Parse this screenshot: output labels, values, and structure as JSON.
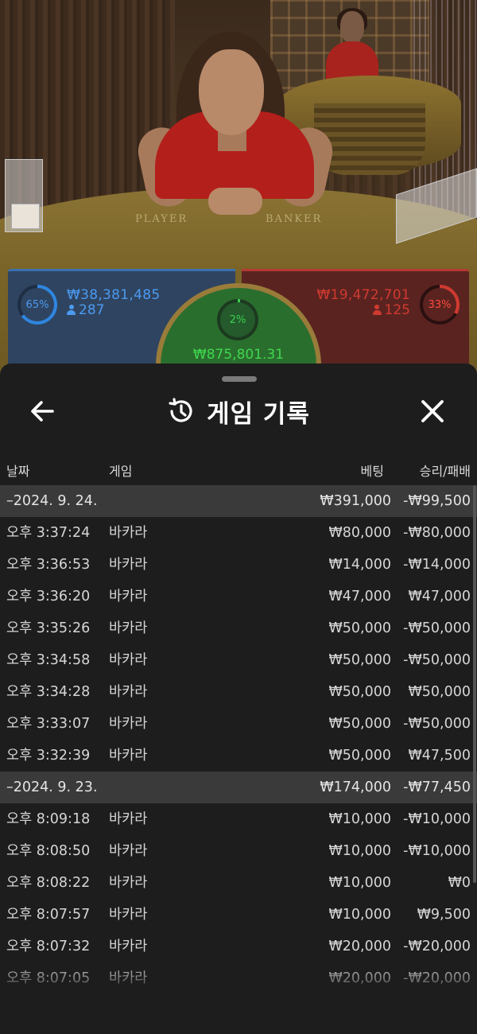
{
  "table": {
    "player_label": "PLAYER",
    "banker_label": "BANKER"
  },
  "bets": {
    "player": {
      "percent_label": "65%",
      "percent": 65,
      "amount": "₩38,381,485",
      "players": "287",
      "color": "#4b9af0"
    },
    "banker": {
      "percent_label": "33%",
      "percent": 33,
      "amount": "₩19,472,701",
      "players": "125",
      "color": "#d03a30"
    },
    "tie": {
      "percent_label": "2%",
      "percent": 2,
      "amount": "₩875,801.31",
      "color": "#41d64f"
    }
  },
  "sheet": {
    "title": "게임 기록",
    "icons": {
      "back": "arrow-left-icon",
      "history": "history-clock-icon",
      "close": "close-x-icon"
    },
    "columns": {
      "date": "날짜",
      "game": "게임",
      "bet": "베팅",
      "result": "승리/패배"
    },
    "rows": [
      {
        "type": "date",
        "time": "–2024. 9. 24.",
        "game": "",
        "bet": "₩391,000",
        "result": "-₩99,500"
      },
      {
        "type": "entry",
        "time": "오후 3:37:24",
        "game": "바카라",
        "bet": "₩80,000",
        "result": "-₩80,000"
      },
      {
        "type": "entry",
        "time": "오후 3:36:53",
        "game": "바카라",
        "bet": "₩14,000",
        "result": "-₩14,000"
      },
      {
        "type": "entry",
        "time": "오후 3:36:20",
        "game": "바카라",
        "bet": "₩47,000",
        "result": "₩47,000"
      },
      {
        "type": "entry",
        "time": "오후 3:35:26",
        "game": "바카라",
        "bet": "₩50,000",
        "result": "-₩50,000"
      },
      {
        "type": "entry",
        "time": "오후 3:34:58",
        "game": "바카라",
        "bet": "₩50,000",
        "result": "-₩50,000"
      },
      {
        "type": "entry",
        "time": "오후 3:34:28",
        "game": "바카라",
        "bet": "₩50,000",
        "result": "₩50,000"
      },
      {
        "type": "entry",
        "time": "오후 3:33:07",
        "game": "바카라",
        "bet": "₩50,000",
        "result": "-₩50,000"
      },
      {
        "type": "entry",
        "time": "오후 3:32:39",
        "game": "바카라",
        "bet": "₩50,000",
        "result": "₩47,500"
      },
      {
        "type": "date",
        "time": "–2024. 9. 23.",
        "game": "",
        "bet": "₩174,000",
        "result": "-₩77,450"
      },
      {
        "type": "entry",
        "time": "오후 8:09:18",
        "game": "바카라",
        "bet": "₩10,000",
        "result": "-₩10,000"
      },
      {
        "type": "entry",
        "time": "오후 8:08:50",
        "game": "바카라",
        "bet": "₩10,000",
        "result": "-₩10,000"
      },
      {
        "type": "entry",
        "time": "오후 8:08:22",
        "game": "바카라",
        "bet": "₩10,000",
        "result": "₩0"
      },
      {
        "type": "entry",
        "time": "오후 8:07:57",
        "game": "바카라",
        "bet": "₩10,000",
        "result": "₩9,500"
      },
      {
        "type": "entry",
        "time": "오후 8:07:32",
        "game": "바카라",
        "bet": "₩20,000",
        "result": "-₩20,000"
      },
      {
        "type": "entry",
        "time": "오후 8:07:05",
        "game": "바카라",
        "bet": "₩20,000",
        "result": "-₩20,000"
      }
    ]
  }
}
